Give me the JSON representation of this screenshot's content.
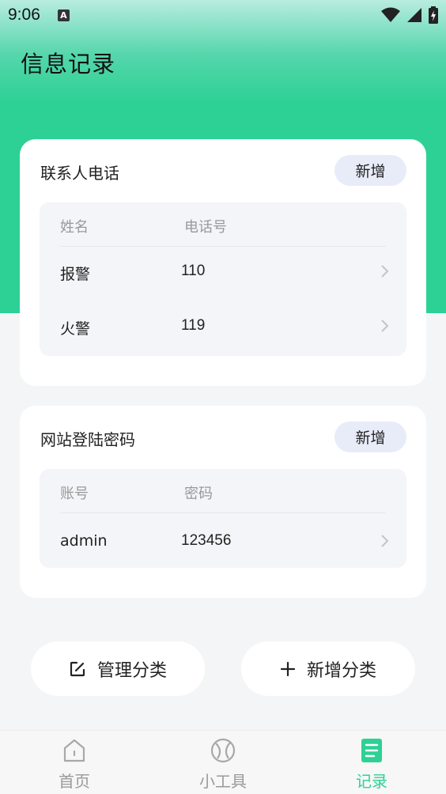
{
  "status_bar": {
    "time": "9:06",
    "notification_icon": "A"
  },
  "header": {
    "title": "信息记录"
  },
  "contacts_card": {
    "title": "联系人电话",
    "add_label": "新增",
    "columns": [
      "姓名",
      "电话号"
    ],
    "rows": [
      {
        "name": "报警",
        "value": "110"
      },
      {
        "name": "火警",
        "value": "119"
      }
    ]
  },
  "passwords_card": {
    "title": "网站登陆密码",
    "add_label": "新增",
    "columns": [
      "账号",
      "密码"
    ],
    "rows": [
      {
        "name": "admin",
        "value": "123456"
      }
    ]
  },
  "actions": {
    "manage_label": "管理分类",
    "new_category_label": "新增分类"
  },
  "tabbar": {
    "items": [
      {
        "label": "首页",
        "icon": "home-icon"
      },
      {
        "label": "小工具",
        "icon": "tools-icon"
      },
      {
        "label": "记录",
        "icon": "record-icon"
      }
    ]
  },
  "colors": {
    "accent": "#2dd195",
    "add_button_bg": "#e8ecf8",
    "table_bg": "#f4f5f8"
  }
}
